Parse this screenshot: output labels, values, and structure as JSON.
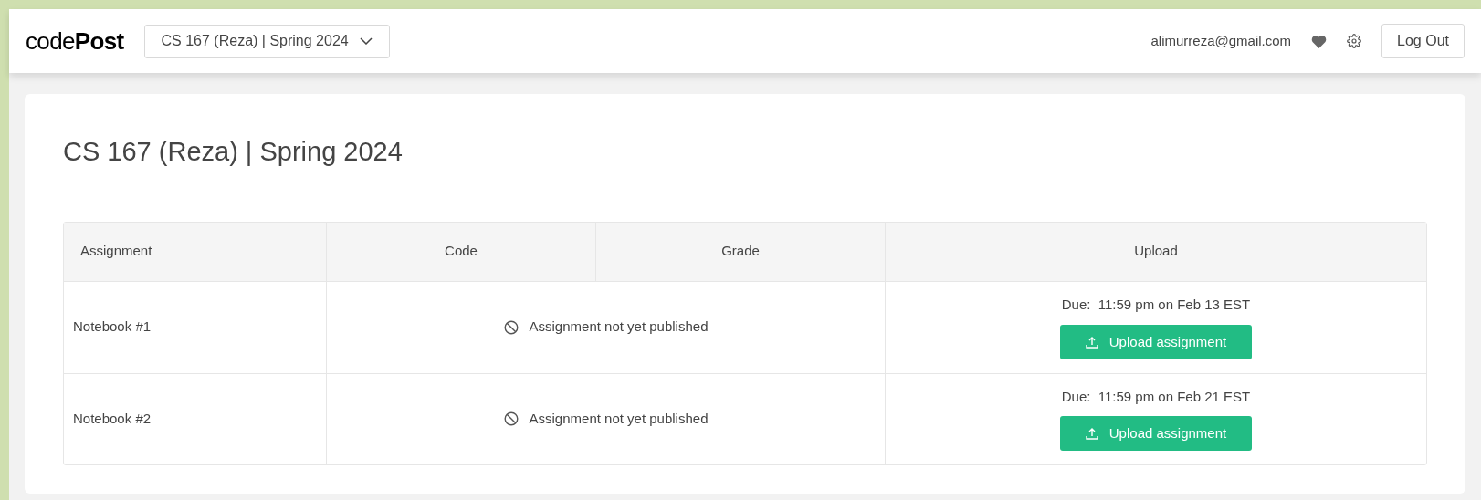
{
  "header": {
    "logo": "code**Post**",
    "course_selector": "CS 167 (Reza) | Spring 2024",
    "email": "alimurreza@gmail.com",
    "logout": "Log Out"
  },
  "page_title": "CS 167 (Reza) | Spring 2024",
  "table": {
    "columns": [
      "Assignment",
      "Code",
      "Grade",
      "Upload"
    ],
    "rows": [
      {
        "assignment": "Notebook #1",
        "status": "Assignment not yet published",
        "due": "Due:  11:59 pm on Feb 13 EST",
        "button": "Upload assignment"
      },
      {
        "assignment": "Notebook #2",
        "status": "Assignment not yet published",
        "due": "Due:  11:59 pm on Feb 21 EST",
        "button": "Upload assignment"
      }
    ]
  }
}
